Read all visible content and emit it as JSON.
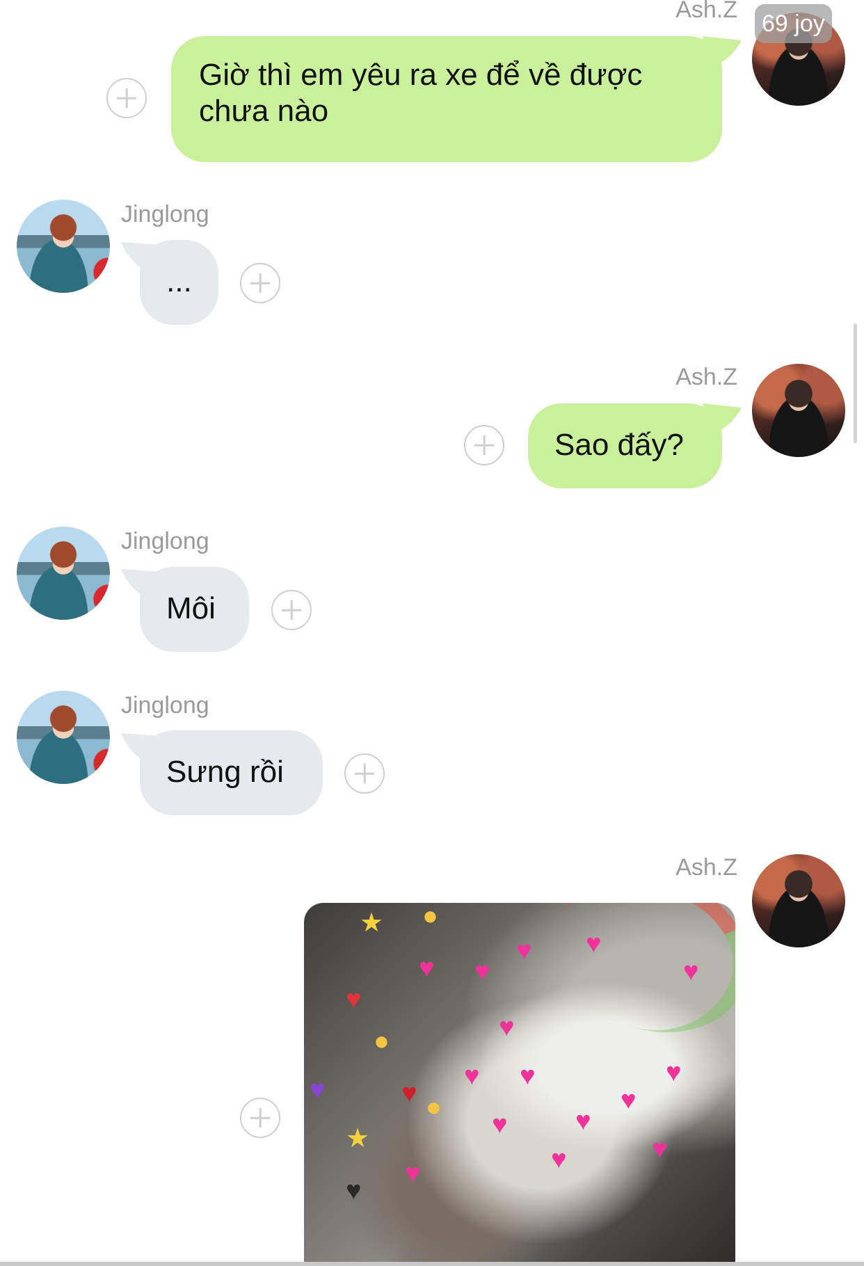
{
  "badge": "69 joy",
  "messages": [
    {
      "sender": "Ash.Z",
      "side": "right",
      "text_lines": [
        "Giờ thì em yêu ra xe để về được",
        "chưa nào"
      ]
    },
    {
      "sender": "Jinglong",
      "side": "left",
      "text": "..."
    },
    {
      "sender": "Ash.Z",
      "side": "right",
      "text": "Sao đấy?"
    },
    {
      "sender": "Jinglong",
      "side": "left",
      "text": "Môi"
    },
    {
      "sender": "Jinglong",
      "side": "left",
      "text": "Sưng rồi"
    },
    {
      "sender": "Ash.Z",
      "side": "right",
      "type": "image",
      "image_content": "cat-with-hearts-sticker"
    }
  ],
  "icons": {
    "add_reaction": "plus-circle-icon",
    "heart": "heart-icon"
  },
  "colors": {
    "outgoing_bubble": "#c9f09a",
    "incoming_bubble": "#e6e9ed",
    "sender_name": "#9a9a9a",
    "reaction_button": "#cfcfcf"
  }
}
